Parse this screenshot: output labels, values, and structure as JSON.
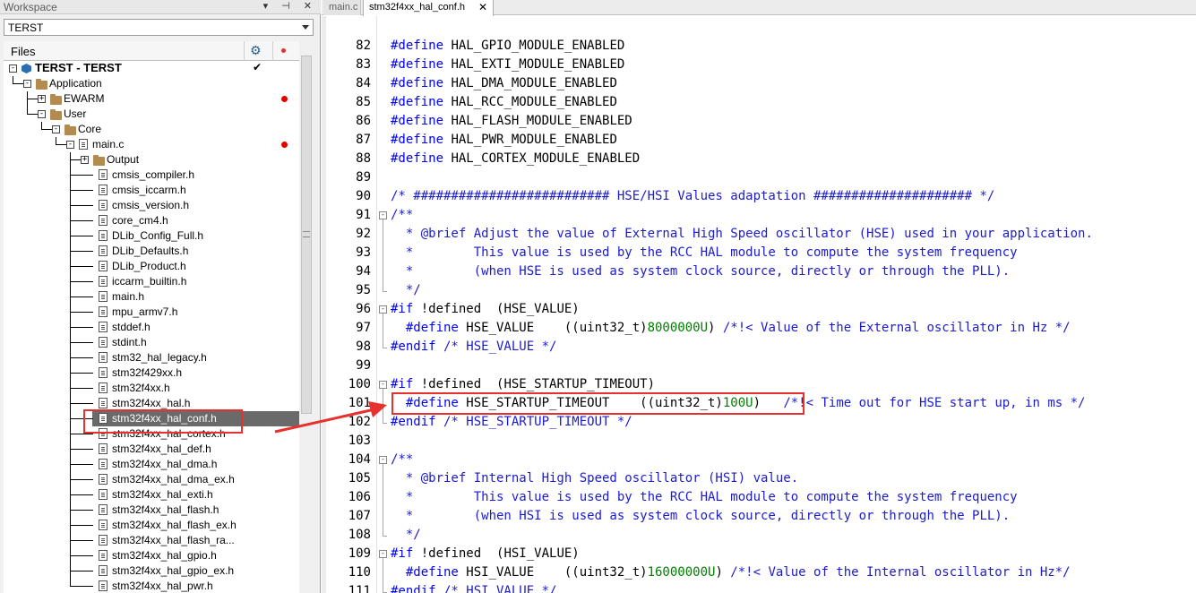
{
  "workspace": {
    "title": "Workspace",
    "buttons": "▾ ⊣ ✕",
    "config_value": "TERST",
    "files_label": "Files",
    "tree": [
      {
        "label": "TERST - TERST",
        "kind": "project",
        "depth": 0,
        "toggle": "-",
        "check": true
      },
      {
        "label": "Application",
        "kind": "folder",
        "depth": 1,
        "toggle": "-"
      },
      {
        "label": "EWARM",
        "kind": "folder",
        "depth": 2,
        "toggle": "+",
        "dot": true
      },
      {
        "label": "User",
        "kind": "folder",
        "depth": 2,
        "toggle": "-"
      },
      {
        "label": "Core",
        "kind": "folder",
        "depth": 3,
        "toggle": "-"
      },
      {
        "label": "main.c",
        "kind": "file",
        "depth": 4,
        "toggle": "-",
        "dot": true
      },
      {
        "label": "Output",
        "kind": "folder",
        "depth": 5,
        "toggle": "+"
      },
      {
        "label": "cmsis_compiler.h",
        "kind": "file",
        "depth": 5
      },
      {
        "label": "cmsis_iccarm.h",
        "kind": "file",
        "depth": 5
      },
      {
        "label": "cmsis_version.h",
        "kind": "file",
        "depth": 5
      },
      {
        "label": "core_cm4.h",
        "kind": "file",
        "depth": 5
      },
      {
        "label": "DLib_Config_Full.h",
        "kind": "file",
        "depth": 5
      },
      {
        "label": "DLib_Defaults.h",
        "kind": "file",
        "depth": 5
      },
      {
        "label": "DLib_Product.h",
        "kind": "file",
        "depth": 5
      },
      {
        "label": "iccarm_builtin.h",
        "kind": "file",
        "depth": 5
      },
      {
        "label": "main.h",
        "kind": "file",
        "depth": 5
      },
      {
        "label": "mpu_armv7.h",
        "kind": "file",
        "depth": 5
      },
      {
        "label": "stddef.h",
        "kind": "file",
        "depth": 5
      },
      {
        "label": "stdint.h",
        "kind": "file",
        "depth": 5
      },
      {
        "label": "stm32_hal_legacy.h",
        "kind": "file",
        "depth": 5
      },
      {
        "label": "stm32f429xx.h",
        "kind": "file",
        "depth": 5
      },
      {
        "label": "stm32f4xx.h",
        "kind": "file",
        "depth": 5
      },
      {
        "label": "stm32f4xx_hal.h",
        "kind": "file",
        "depth": 5
      },
      {
        "label": "stm32f4xx_hal_conf.h",
        "kind": "file",
        "depth": 5,
        "selected": true
      },
      {
        "label": "stm32f4xx_hal_cortex.h",
        "kind": "file",
        "depth": 5
      },
      {
        "label": "stm32f4xx_hal_def.h",
        "kind": "file",
        "depth": 5
      },
      {
        "label": "stm32f4xx_hal_dma.h",
        "kind": "file",
        "depth": 5
      },
      {
        "label": "stm32f4xx_hal_dma_ex.h",
        "kind": "file",
        "depth": 5
      },
      {
        "label": "stm32f4xx_hal_exti.h",
        "kind": "file",
        "depth": 5
      },
      {
        "label": "stm32f4xx_hal_flash.h",
        "kind": "file",
        "depth": 5
      },
      {
        "label": "stm32f4xx_hal_flash_ex.h",
        "kind": "file",
        "depth": 5
      },
      {
        "label": "stm32f4xx_hal_flash_ra...",
        "kind": "file",
        "depth": 5
      },
      {
        "label": "stm32f4xx_hal_gpio.h",
        "kind": "file",
        "depth": 5
      },
      {
        "label": "stm32f4xx_hal_gpio_ex.h",
        "kind": "file",
        "depth": 5
      },
      {
        "label": "stm32f4xx_hal_pwr.h",
        "kind": "file",
        "depth": 5
      }
    ]
  },
  "editor": {
    "tabs": [
      {
        "label": "main.c",
        "active": false
      },
      {
        "label": "stm32f4xx_hal_conf.h",
        "active": true,
        "close": "✕"
      }
    ],
    "lines": [
      {
        "n": "82",
        "parts": [
          [
            "kw",
            "#define"
          ],
          [
            "",
            " HAL_GPIO_MODULE_ENABLED"
          ]
        ]
      },
      {
        "n": "83",
        "parts": [
          [
            "kw",
            "#define"
          ],
          [
            "",
            " HAL_EXTI_MODULE_ENABLED"
          ]
        ]
      },
      {
        "n": "84",
        "parts": [
          [
            "kw",
            "#define"
          ],
          [
            "",
            " HAL_DMA_MODULE_ENABLED"
          ]
        ]
      },
      {
        "n": "85",
        "parts": [
          [
            "kw",
            "#define"
          ],
          [
            "",
            " HAL_RCC_MODULE_ENABLED"
          ]
        ]
      },
      {
        "n": "86",
        "parts": [
          [
            "kw",
            "#define"
          ],
          [
            "",
            " HAL_FLASH_MODULE_ENABLED"
          ]
        ]
      },
      {
        "n": "87",
        "parts": [
          [
            "kw",
            "#define"
          ],
          [
            "",
            " HAL_PWR_MODULE_ENABLED"
          ]
        ]
      },
      {
        "n": "88",
        "parts": [
          [
            "kw",
            "#define"
          ],
          [
            "",
            " HAL_CORTEX_MODULE_ENABLED"
          ]
        ]
      },
      {
        "n": "89",
        "parts": []
      },
      {
        "n": "90",
        "parts": [
          [
            "cm",
            "/* ########################## HSE/HSI Values adaptation ##################### */"
          ]
        ]
      },
      {
        "n": "91",
        "fold": "-",
        "parts": [
          [
            "cm",
            "/**"
          ]
        ]
      },
      {
        "n": "92",
        "parts": [
          [
            "cm",
            "  * @brief Adjust the value of External High Speed oscillator (HSE) used in your application."
          ]
        ]
      },
      {
        "n": "93",
        "parts": [
          [
            "cm",
            "  *        This value is used by the RCC HAL module to compute the system frequency"
          ]
        ]
      },
      {
        "n": "94",
        "parts": [
          [
            "cm",
            "  *        (when HSE is used as system clock source, directly or through the PLL)."
          ]
        ]
      },
      {
        "n": "95",
        "parts": [
          [
            "cm",
            "  */"
          ]
        ]
      },
      {
        "n": "96",
        "fold": "-",
        "parts": [
          [
            "kw",
            "#if"
          ],
          [
            "",
            " !defined  (HSE_VALUE)"
          ]
        ]
      },
      {
        "n": "97",
        "parts": [
          [
            "kw",
            "  #define"
          ],
          [
            "",
            " HSE_VALUE    ((uint32_t)"
          ],
          [
            "num",
            "8000000U"
          ],
          [
            "",
            ") "
          ],
          [
            "cm",
            "/*!< Value of the External oscillator in Hz */"
          ]
        ]
      },
      {
        "n": "98",
        "parts": [
          [
            "kw",
            "#endif"
          ],
          [
            "cm",
            " /* HSE_VALUE */"
          ]
        ]
      },
      {
        "n": "99",
        "parts": []
      },
      {
        "n": "100",
        "fold": "-",
        "parts": [
          [
            "kw",
            "#if"
          ],
          [
            "",
            " !defined  (HSE_STARTUP_TIMEOUT)"
          ]
        ]
      },
      {
        "n": "101",
        "parts": [
          [
            "kw",
            "  #define"
          ],
          [
            "",
            " HSE_STARTUP_TIMEOUT    ((uint32_t)"
          ],
          [
            "num",
            "100U"
          ],
          [
            "",
            ")   "
          ],
          [
            "cm",
            "/*!< Time out for HSE start up, in ms */"
          ]
        ]
      },
      {
        "n": "102",
        "parts": [
          [
            "kw",
            "#endif"
          ],
          [
            "cm",
            " /* HSE_STARTUP_TIMEOUT */"
          ]
        ]
      },
      {
        "n": "103",
        "parts": []
      },
      {
        "n": "104",
        "fold": "-",
        "parts": [
          [
            "cm",
            "/**"
          ]
        ]
      },
      {
        "n": "105",
        "parts": [
          [
            "cm",
            "  * @brief Internal High Speed oscillator (HSI) value."
          ]
        ]
      },
      {
        "n": "106",
        "parts": [
          [
            "cm",
            "  *        This value is used by the RCC HAL module to compute the system frequency"
          ]
        ]
      },
      {
        "n": "107",
        "parts": [
          [
            "cm",
            "  *        (when HSI is used as system clock source, directly or through the PLL)."
          ]
        ]
      },
      {
        "n": "108",
        "parts": [
          [
            "cm",
            "  */"
          ]
        ]
      },
      {
        "n": "109",
        "fold": "-",
        "parts": [
          [
            "kw",
            "#if"
          ],
          [
            "",
            " !defined  (HSI_VALUE)"
          ]
        ]
      },
      {
        "n": "110",
        "parts": [
          [
            "kw",
            "  #define"
          ],
          [
            "",
            " HSI_VALUE    ((uint32_t)"
          ],
          [
            "num",
            "16000000U"
          ],
          [
            "",
            ") "
          ],
          [
            "cm",
            "/*!< Value of the Internal oscillator in Hz*/"
          ]
        ]
      },
      {
        "n": "111",
        "parts": [
          [
            "kw",
            "#endif"
          ],
          [
            "cm",
            " /* HSI_VALUE */"
          ]
        ]
      }
    ]
  },
  "colors": {
    "annotation": "#e8302d",
    "keyword": "#0000ff",
    "comment": "#1b1bd0",
    "number": "#008000",
    "selection": "#6a6a6a"
  }
}
